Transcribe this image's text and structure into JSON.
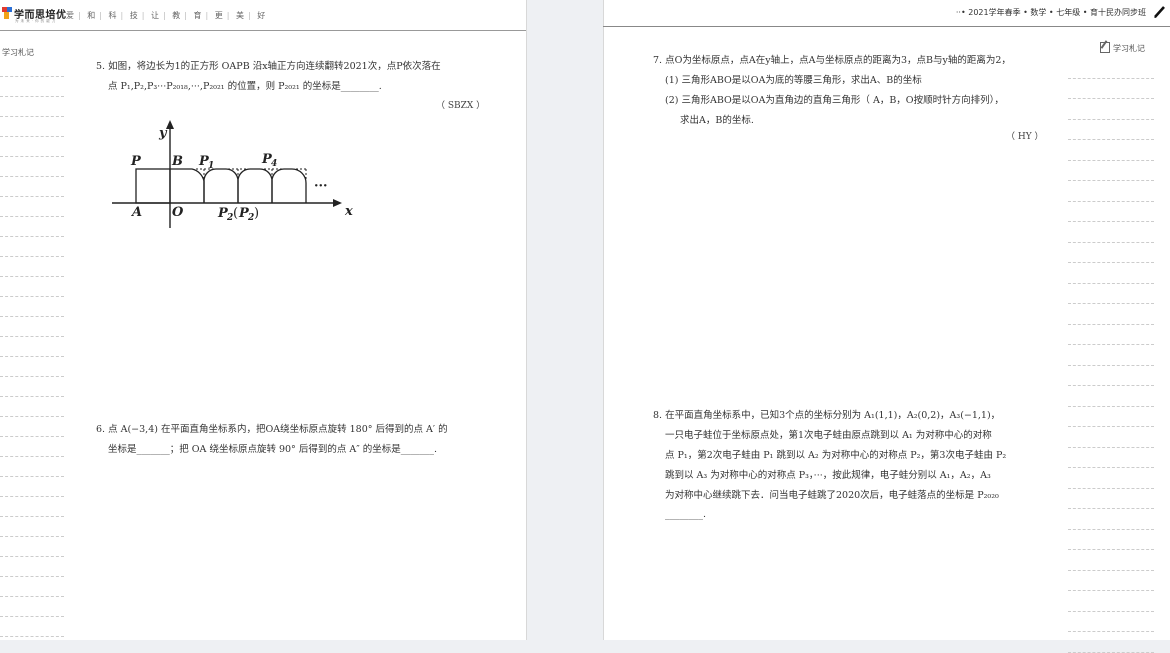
{
  "left_page": {
    "brand": {
      "name": "学而思培优",
      "tagline": "为 未 来 · 你 的 能 力"
    },
    "slogan_chars": [
      "爱",
      "和",
      "科",
      "技",
      "让",
      "教",
      "育",
      "更",
      "美",
      "好"
    ],
    "notes_label": "学习札记",
    "q5": {
      "line1": "5. 如图，将边长为1的正方形 OAPB 沿x轴正方向连续翻转2021次，点P依次落在",
      "line2": "点 P₁,P₂,P₃···P₂₀₁₈,···,P₂₀₂₁ 的位置，则 P₂₀₂₁ 的坐标是________.",
      "source": "（ SBZX ）",
      "figure_labels": {
        "y": "y",
        "x": "x",
        "P": "P",
        "B": "B",
        "A": "A",
        "O": "O",
        "P1": "P",
        "P1_sub": "1",
        "P4": "P",
        "P4_sub": "4",
        "P2": "P",
        "P2_sub": "2",
        "P2b": "P",
        "P2b_sub": "2",
        "dots": "···"
      }
    },
    "q6": {
      "line1": "6. 点 A(−3,4) 在平面直角坐标系内，把OA绕坐标原点旋转 180° 后得到的点 A′ 的",
      "line2": "坐标是_______；把 OA 绕坐标原点旋转 90° 后得到的点 A″ 的坐标是_______."
    }
  },
  "right_page": {
    "header_title": "··• 2021学年春季 • 数学 • 七年级 • 育十民办同步班",
    "notes_label": "学习札记",
    "q7": {
      "line1": "7. 点O为坐标原点，点A在y轴上，点A与坐标原点的距离为3，点B与y轴的距离为2，",
      "line2": "(1) 三角形ABO是以OA为底的等腰三角形，求出A、B的坐标",
      "line3": "(2) 三角形ABO是以OA为直角边的直角三角形（ A，B，O按顺时针方向排列），",
      "line4": "求出A，B的坐标.",
      "source": "（ HY ）"
    },
    "q8": {
      "line1": "8. 在平面直角坐标系中，已知3个点的坐标分别为 A₁(1,1)，A₂(0,2)，A₃(−1,1)，",
      "line2": "一只电子蛙位于坐标原点处，第1次电子蛙由原点跳到以 A₁ 为对称中心的对称",
      "line3": "点 P₁，第2次电子蛙由 P₁ 跳到以 A₂ 为对称中心的对称点 P₂，第3次电子蛙由 P₂",
      "line4": "跳到以 A₃ 为对称中心的对称点 P₃，···，按此规律，电子蛙分别以 A₁，A₂，A₃",
      "line5": "为对称中心继续跳下去．问当电子蛙跳了2020次后，电子蛙落点的坐标是 P₂₀₂₀",
      "line6": "________."
    }
  }
}
